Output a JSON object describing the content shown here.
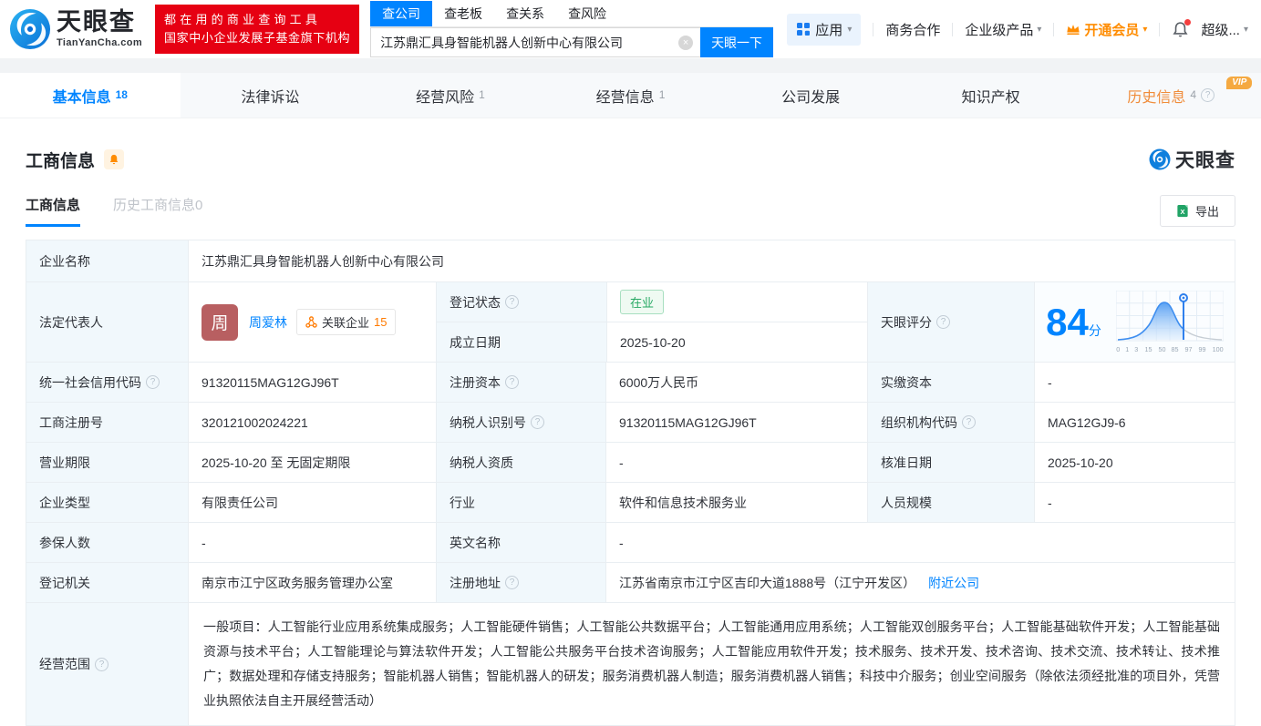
{
  "brand": {
    "name": "天眼查",
    "domain": "TianYanCha.com"
  },
  "promo": {
    "line1": "都在用的商业查询工具",
    "line2": "国家中小企业发展子基金旗下机构"
  },
  "search": {
    "tabs": [
      {
        "label": "查公司"
      },
      {
        "label": "查老板"
      },
      {
        "label": "查关系"
      },
      {
        "label": "查风险"
      }
    ],
    "value": "江苏鼎汇具身智能机器人创新中心有限公司",
    "button": "天眼一下"
  },
  "topnav": {
    "apps": "应用",
    "biz_coop": "商务合作",
    "enterprise": "企业级产品",
    "vip": "开通会员",
    "user": "超级..."
  },
  "main_tabs": [
    {
      "label": "基本信息",
      "count": "18"
    },
    {
      "label": "法律诉讼",
      "count": ""
    },
    {
      "label": "经营风险",
      "count": "1"
    },
    {
      "label": "经营信息",
      "count": "1"
    },
    {
      "label": "公司发展",
      "count": ""
    },
    {
      "label": "知识产权",
      "count": ""
    },
    {
      "label": "历史信息",
      "count": "4",
      "vip_tag": "VIP"
    }
  ],
  "section": {
    "title": "工商信息",
    "subtab_active": "工商信息",
    "subtab_history": "历史工商信息",
    "subtab_history_count": "0",
    "export": "导出",
    "watermark": "天眼查"
  },
  "icons": {
    "help": "?",
    "clear": "×",
    "caret": "▾"
  },
  "table": {
    "company_name": {
      "label": "企业名称",
      "value": "江苏鼎汇具身智能机器人创新中心有限公司"
    },
    "legal_rep": {
      "label": "法定代表人",
      "avatar": "周",
      "name": "周爱林",
      "badge": "关联企业",
      "badge_count": "15"
    },
    "reg_status": {
      "label": "登记状态",
      "value": "在业"
    },
    "establish_date": {
      "label": "成立日期",
      "value": "2025-10-20"
    },
    "score": {
      "label": "天眼评分",
      "value": "84",
      "unit": "分",
      "axis": [
        "0",
        "1",
        "3",
        "15",
        "50",
        "85",
        "97",
        "99",
        "100"
      ]
    },
    "credit_code": {
      "label": "统一社会信用代码",
      "value": "91320115MAG12GJ96T"
    },
    "reg_capital": {
      "label": "注册资本",
      "value": "6000万人民币"
    },
    "paid_capital": {
      "label": "实缴资本",
      "value": "-"
    },
    "reg_number": {
      "label": "工商注册号",
      "value": "320121002024221"
    },
    "taxpayer_id": {
      "label": "纳税人识别号",
      "value": "91320115MAG12GJ96T"
    },
    "org_code": {
      "label": "组织机构代码",
      "value": "MAG12GJ9-6"
    },
    "business_term": {
      "label": "营业期限",
      "value": "2025-10-20 至 无固定期限"
    },
    "taxpayer_quality": {
      "label": "纳税人资质",
      "value": "-"
    },
    "approval_date": {
      "label": "核准日期",
      "value": "2025-10-20"
    },
    "company_type": {
      "label": "企业类型",
      "value": "有限责任公司"
    },
    "industry": {
      "label": "行业",
      "value": "软件和信息技术服务业"
    },
    "staff_size": {
      "label": "人员规模",
      "value": "-"
    },
    "insured_count": {
      "label": "参保人数",
      "value": "-"
    },
    "english_name": {
      "label": "英文名称",
      "value": "-"
    },
    "reg_authority": {
      "label": "登记机关",
      "value": "南京市江宁区政务服务管理办公室"
    },
    "reg_address": {
      "label": "注册地址",
      "value": "江苏省南京市江宁区吉印大道1888号（江宁开发区）",
      "link": "附近公司"
    },
    "business_scope": {
      "label": "经营范围",
      "value": "一般项目：人工智能行业应用系统集成服务；人工智能硬件销售；人工智能公共数据平台；人工智能通用应用系统；人工智能双创服务平台；人工智能基础软件开发；人工智能基础资源与技术平台；人工智能理论与算法软件开发；人工智能公共服务平台技术咨询服务；人工智能应用软件开发；技术服务、技术开发、技术咨询、技术交流、技术转让、技术推广；数据处理和存储支持服务；智能机器人销售；智能机器人的研发；服务消费机器人制造；服务消费机器人销售；科技中介服务；创业空间服务（除依法须经批准的项目外，凭营业执照依法自主开展经营活动）"
    }
  },
  "colors": {
    "accent": "#0084ff",
    "orange": "#ff8c00",
    "green": "#26a863",
    "red": "#e60012"
  }
}
